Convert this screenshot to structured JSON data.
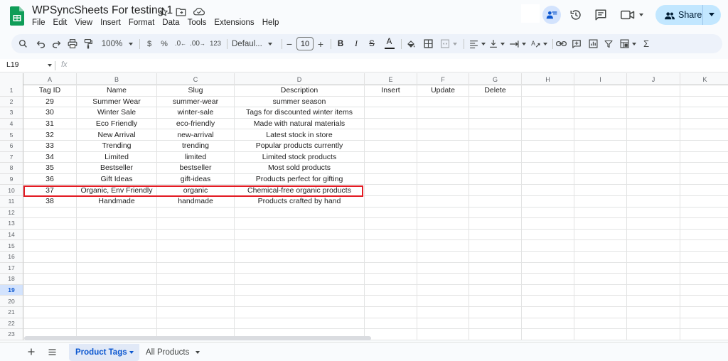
{
  "app": {
    "title": "WPSyncSheets For testing 1",
    "menu": [
      "File",
      "Edit",
      "View",
      "Insert",
      "Format",
      "Data",
      "Tools",
      "Extensions",
      "Help"
    ],
    "share_label": "Share",
    "colors": {
      "share_bg": "#c2e7ff",
      "accent": "#0b57d0",
      "highlight_border": "#e31b23"
    }
  },
  "toolbar": {
    "zoom": "100%",
    "currency": "$",
    "percent": "%",
    "dec_decrease": ".0",
    "dec_increase": ".00",
    "number_format": "123",
    "font_family": "Defaul...",
    "font_size": "10",
    "minus": "−",
    "plus": "+",
    "bold": "B",
    "italic": "I",
    "strike": "S",
    "text_color": "A",
    "sigma": "Σ"
  },
  "formula_bar": {
    "name_box": "L19",
    "fx": "fx"
  },
  "grid": {
    "columns": [
      "A",
      "B",
      "C",
      "D",
      "E",
      "F",
      "G",
      "H",
      "I",
      "J",
      "K"
    ],
    "row_numbers": [
      "1",
      "2",
      "3",
      "4",
      "5",
      "6",
      "7",
      "8",
      "9",
      "10",
      "11",
      "12",
      "13",
      "14",
      "15",
      "16",
      "17",
      "18",
      "19",
      "20",
      "21",
      "22",
      "23"
    ],
    "selected_row": "19",
    "header": [
      "Tag ID",
      "Name",
      "Slug",
      "Description",
      "Insert",
      "Update",
      "Delete"
    ],
    "rows": [
      [
        "29",
        "Summer Wear",
        "summer-wear",
        "summer season"
      ],
      [
        "30",
        "Winter Sale",
        "winter-sale",
        "Tags for discounted winter items"
      ],
      [
        "31",
        "Eco Friendly",
        "eco-friendly",
        "Made with natural materials"
      ],
      [
        "32",
        "New Arrival",
        "new-arrival",
        "Latest stock in store"
      ],
      [
        "33",
        "Trending",
        "trending",
        "Popular products currently"
      ],
      [
        "34",
        "Limited",
        "limited",
        "Limited stock products"
      ],
      [
        "35",
        "Bestseller",
        "bestseller",
        "Most sold products"
      ],
      [
        "36",
        "Gift Ideas",
        "gift-ideas",
        "Products perfect for gifting"
      ],
      [
        "37",
        "Organic, Env Friendly",
        "organic",
        "Chemical-free organic products"
      ],
      [
        "38",
        "Handmade",
        "handmade",
        "Products crafted by hand"
      ]
    ]
  },
  "sheets": {
    "tabs": [
      {
        "label": "Product Tags",
        "active": true
      },
      {
        "label": "All Products",
        "active": false
      }
    ]
  }
}
